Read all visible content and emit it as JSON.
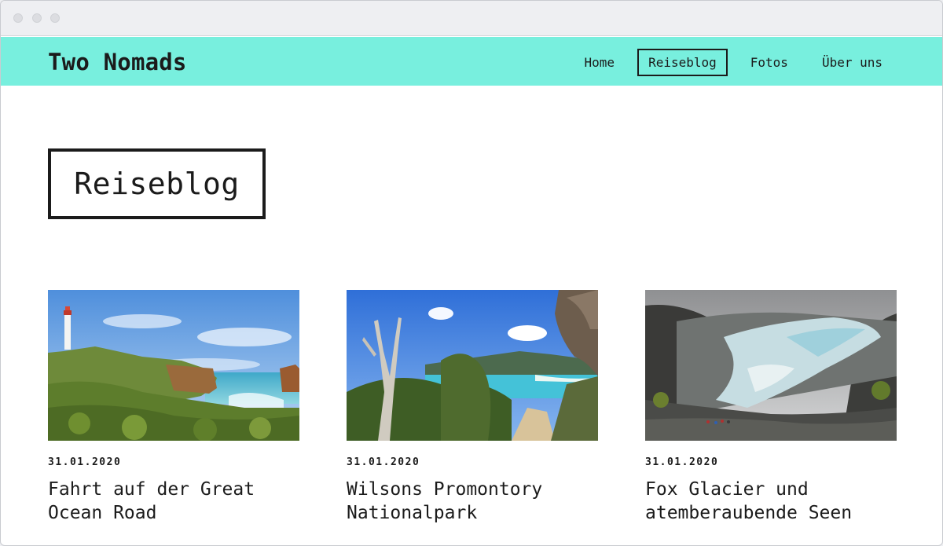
{
  "site": {
    "brand": "Two Nomads"
  },
  "nav": {
    "items": [
      {
        "label": "Home",
        "active": false
      },
      {
        "label": "Reiseblog",
        "active": true
      },
      {
        "label": "Fotos",
        "active": false
      },
      {
        "label": "Über uns",
        "active": false
      }
    ]
  },
  "page": {
    "title": "Reiseblog"
  },
  "posts": [
    {
      "date": "31.01.2020",
      "title": "Fahrt auf der Great Ocean Road"
    },
    {
      "date": "31.01.2020",
      "title": "Wilsons Promontory Nationalpark"
    },
    {
      "date": "31.01.2020",
      "title": "Fox Glacier und atemberaubende Seen"
    }
  ],
  "colors": {
    "accent": "#78efde",
    "text": "#1b1b1b",
    "background": "#ffffff"
  }
}
